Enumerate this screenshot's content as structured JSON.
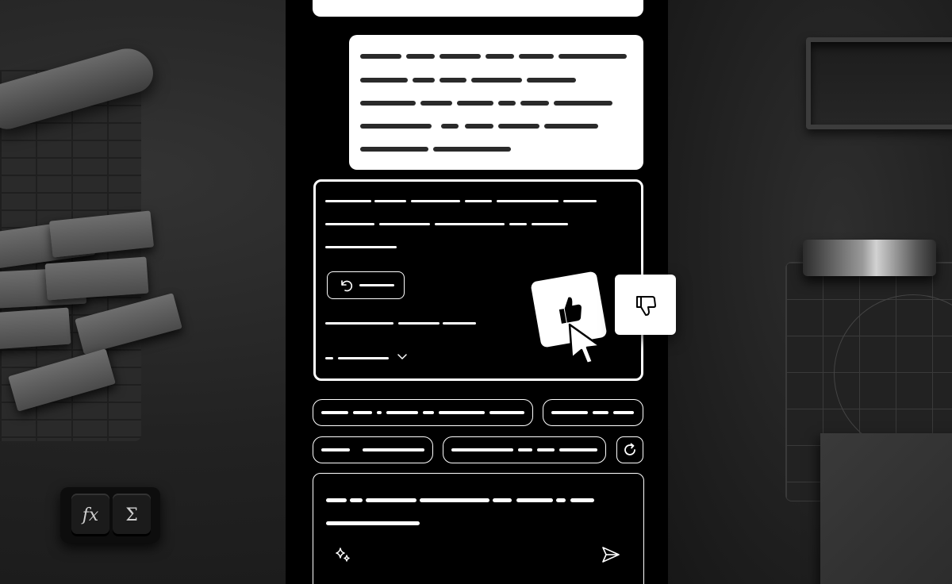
{
  "keys": {
    "fx": "fx",
    "sum": "Σ"
  },
  "icons": {
    "regenerate": "undo-arrow-icon",
    "like": "thumbs-up-icon",
    "dislike": "thumbs-down-icon",
    "pointer": "cursor-arrow-icon",
    "expand": "chevron-down-icon",
    "refresh": "refresh-icon",
    "ai_assist": "sparkle-icon",
    "send": "send-icon"
  },
  "colors": {
    "panel": "#000000",
    "bubble": "#ffffff",
    "outline": "#ffffff",
    "background": "#1c1c1c"
  }
}
